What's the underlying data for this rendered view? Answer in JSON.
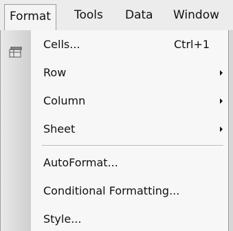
{
  "menubar": {
    "items": [
      {
        "label": "Format"
      },
      {
        "label": "Tools"
      },
      {
        "label": "Data"
      },
      {
        "label": "Window"
      }
    ]
  },
  "format_menu": {
    "items": [
      {
        "label": "Cells...",
        "shortcut": "Ctrl+1",
        "icon": "cells-icon"
      },
      {
        "label": "Row",
        "submenu": true
      },
      {
        "label": "Column",
        "submenu": true
      },
      {
        "label": "Sheet",
        "submenu": true
      },
      {
        "label": "AutoFormat..."
      },
      {
        "label": "Conditional Formatting..."
      },
      {
        "label": "Style..."
      }
    ]
  }
}
